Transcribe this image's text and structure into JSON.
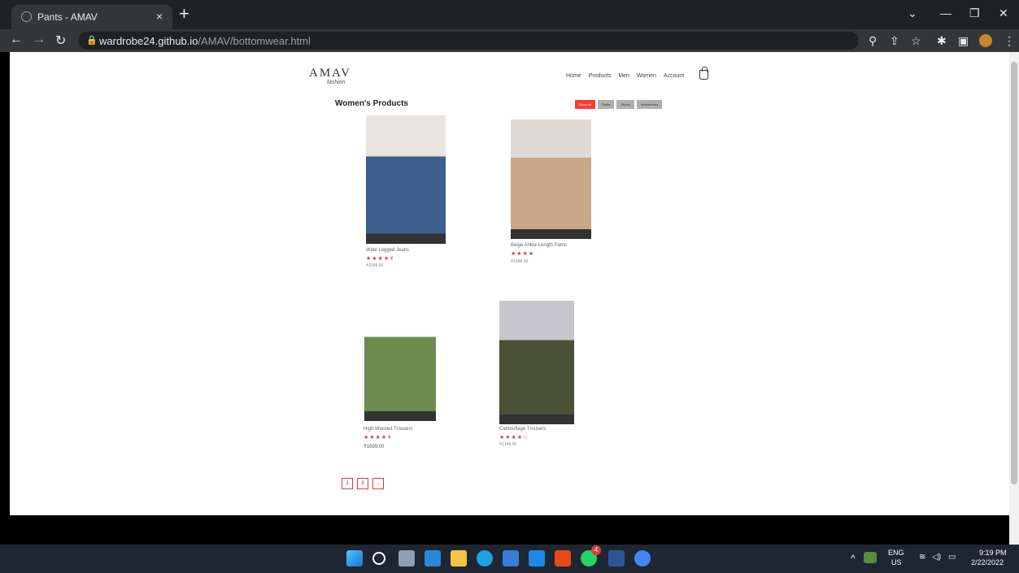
{
  "browser": {
    "tab_title": "Pants - AMAV",
    "tab_close": "×",
    "new_tab": "+",
    "url_host": "wardrobe24.github.io",
    "url_path": "/AMAV/bottomwear.html"
  },
  "site": {
    "logo": "AMAV",
    "logo_sub": "fashion",
    "nav": [
      "Home",
      "Products",
      "Men",
      "Women",
      "Account"
    ]
  },
  "main": {
    "heading": "Women's Products",
    "filters": [
      "Show all",
      "Pants",
      "Shoes",
      "Accessories"
    ],
    "active_filter": "Show all",
    "products": [
      {
        "name": "Wide Legged Jeans",
        "stars": "★★★★⯨",
        "price": "₹1699.00",
        "colors": [
          "#e8e4df",
          "#3d5f8e"
        ]
      },
      {
        "name": "Beige Ankle-Length Pants",
        "stars": "★★★★",
        "price": "₹1699.00",
        "colors": [
          "#dedbd6",
          "#c9a78a"
        ]
      },
      {
        "name": "High Waisted Trousers",
        "stars": "★★★★⯨",
        "price": "₹1699.00",
        "colors": [
          "#ffffff",
          "#6f8a4e"
        ]
      },
      {
        "name": "Camouflage Trousers",
        "stars": "★★★★☆",
        "price": "₹1749.00",
        "colors": [
          "#c7c6cc",
          "#4b5136"
        ]
      }
    ],
    "pagination": [
      "1",
      "2",
      "→"
    ]
  },
  "taskbar": {
    "lang_top": "ENG",
    "lang_bottom": "US",
    "time": "9:19 PM",
    "date": "2/22/2022",
    "whatsapp_badge": "4"
  }
}
